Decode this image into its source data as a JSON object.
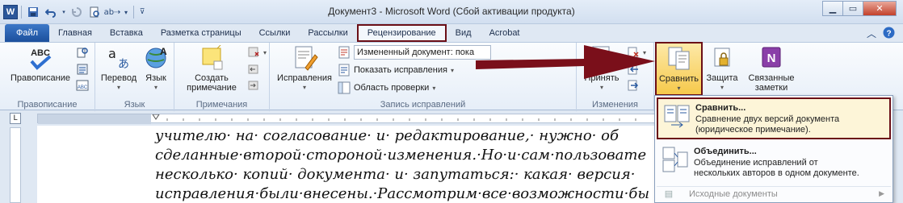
{
  "window": {
    "title": "Документ3  -  Microsoft Word (Сбой активации продукта)"
  },
  "quick_access": {
    "icons": [
      "word-logo",
      "save-icon",
      "undo-icon",
      "redo-icon",
      "print-preview-icon",
      "format-painter-icon",
      "customize-icon"
    ]
  },
  "tabs": [
    {
      "label": "Файл",
      "kind": "file"
    },
    {
      "label": "Главная"
    },
    {
      "label": "Вставка"
    },
    {
      "label": "Разметка страницы"
    },
    {
      "label": "Ссылки"
    },
    {
      "label": "Рассылки"
    },
    {
      "label": "Рецензирование",
      "active": true
    },
    {
      "label": "Вид"
    },
    {
      "label": "Acrobat"
    }
  ],
  "ribbon": {
    "proofing": {
      "group_label": "Правописание",
      "spelling_label": "Правописание"
    },
    "language": {
      "group_label": "Язык",
      "translate_label": "Перевод",
      "language_label": "Язык"
    },
    "comments": {
      "group_label": "Примечания",
      "new_comment_label": "Создать примечание"
    },
    "tracking": {
      "group_label": "Запись исправлений",
      "track_changes_label": "Исправления",
      "display_combo": "Измененный документ: пока",
      "show_markup_label": "Показать исправления",
      "reviewing_pane_label": "Область проверки"
    },
    "changes": {
      "group_label": "Изменения",
      "accept_label": "Принять"
    },
    "compare": {
      "compare_label": "Сравнить"
    },
    "protect": {
      "protect_label": "Защита"
    },
    "onenote": {
      "linked_notes_label": "Связанные заметки"
    }
  },
  "dropdown": {
    "items": [
      {
        "title": "Сравнить...",
        "desc1": "Сравнение двух версий документа",
        "desc2": "(юридическое примечание)."
      },
      {
        "title": "Объединить...",
        "desc1": "Объединение исправлений от",
        "desc2": "нескольких авторов в одном документе."
      }
    ],
    "footer": "Исходные документы"
  },
  "document": {
    "lines": [
      "учителю· на· согласование· и· редактирование,· нужно· об",
      "сделанные·второй·стороной·изменения.·Но·и·сам·пользовате",
      "несколько· копий· документа· и· запутаться:· какая· версия·",
      "исправления·были·внесены.·Рассмотрим·все·возможности·бы"
    ]
  },
  "colors": {
    "highlight_border": "#6b0f17",
    "arrow": "#7a0f1a",
    "file_tab": "#2b5fad"
  }
}
